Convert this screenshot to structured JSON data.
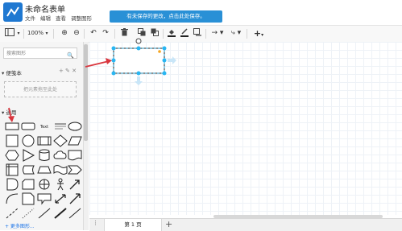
{
  "app": {
    "title": "未命名表单",
    "notice": "有未保存的更改，点击此处保存。"
  },
  "menu": [
    {
      "label": "文件"
    },
    {
      "label": "编辑"
    },
    {
      "label": "查看"
    },
    {
      "label": "调整图形"
    }
  ],
  "toolbar": {
    "zoom": "100%",
    "zoom_in": "⊕",
    "zoom_out": "⊖",
    "undo": "↶",
    "redo": "↷",
    "delete": "🗑",
    "fill_icon": "fill-color-icon",
    "add": "+"
  },
  "sidebar": {
    "search_placeholder": "搜索图形",
    "scratchpad_label": "便笺本",
    "scratchpad_hint": "把元素拖至此处",
    "general_label": "通用",
    "more_shapes": "+ 更多图形..."
  },
  "pages": {
    "tab_label": "第 1 页",
    "add_label": "+"
  },
  "colors": {
    "accent": "#2990d6",
    "selection": "#29b6f2",
    "arrow": "#d9363e"
  }
}
